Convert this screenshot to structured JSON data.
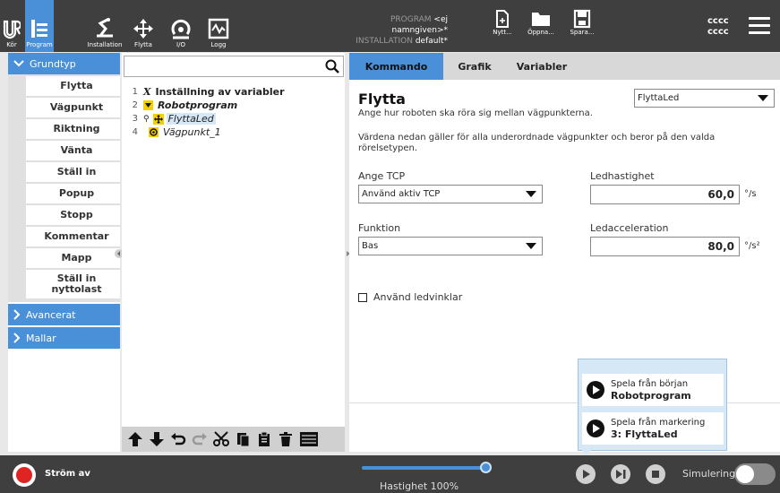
{
  "topbar": {
    "nav": [
      {
        "label": "Kör",
        "icon": "ur-logo-icon"
      },
      {
        "label": "Program",
        "icon": "program-icon"
      },
      {
        "label": "Installation",
        "icon": "installation-icon"
      },
      {
        "label": "Flytta",
        "icon": "move-icon"
      },
      {
        "label": "I/O",
        "icon": "io-icon"
      },
      {
        "label": "Logg",
        "icon": "log-icon"
      }
    ],
    "program_label": "PROGRAM",
    "program_value": "<ej namngiven>*",
    "installation_label": "INSTALLATION",
    "installation_value": "default*",
    "file_buttons": [
      {
        "label": "Nytt...",
        "icon": "new-file-icon"
      },
      {
        "label": "Öppna...",
        "icon": "open-folder-icon"
      },
      {
        "label": "Spara...",
        "icon": "save-icon"
      }
    ],
    "robot_name_line1": "cccc",
    "robot_name_line2": "cccc"
  },
  "sidebar": {
    "basic_label": "Grundtyp",
    "items": [
      "Flytta",
      "Vägpunkt",
      "Riktning",
      "Vänta",
      "Ställ in",
      "Popup",
      "Stopp",
      "Kommentar",
      "Mapp",
      "Ställ in nyttolast"
    ],
    "advanced_label": "Avancerat",
    "templates_label": "Mallar"
  },
  "tree": {
    "search_placeholder": "",
    "rows": [
      {
        "num": "1",
        "text": "Inställning av variabler",
        "icon": "variable-x-icon"
      },
      {
        "num": "2",
        "text": "Robotprogram",
        "icon": "program-triangle-icon"
      },
      {
        "num": "3",
        "text": "FlyttaLed",
        "icon": "move-joint-icon"
      },
      {
        "num": "4",
        "text": "Vägpunkt_1",
        "icon": "waypoint-icon"
      }
    ]
  },
  "main": {
    "tabs": [
      "Kommando",
      "Grafik",
      "Variabler"
    ],
    "title": "Flytta",
    "description": "Ange hur roboten ska röra sig mellan vägpunkterna.",
    "note": "Värdena nedan gäller för alla underordnade vägpunkter och beror på den valda rörelsetypen.",
    "move_type": "FlyttaLed",
    "tcp_label": "Ange TCP",
    "tcp_value": "Använd aktiv TCP",
    "feature_label": "Funktion",
    "feature_value": "Bas",
    "joint_speed_label": "Ledhastighet",
    "joint_speed_value": "60,0",
    "joint_speed_unit": "°/s",
    "joint_accel_label": "Ledacceleration",
    "joint_accel_value": "80,0",
    "joint_accel_unit": "°/s²",
    "use_joint_angles_label": "Använd ledvinklar"
  },
  "play_popup": {
    "item1_line1": "Spela från början",
    "item1_line2": "Robotprogram",
    "item2_line1": "Spela från markering",
    "item2_line2": "3: FlyttaLed"
  },
  "footer": {
    "power_label": "Ström av",
    "speed_label": "Hastighet 100%",
    "speed_percent": 100,
    "simulation_label": "Simulering"
  },
  "colors": {
    "accent": "#4a90d9",
    "topbar": "#3f3f3f",
    "power_off": "#e02424"
  }
}
